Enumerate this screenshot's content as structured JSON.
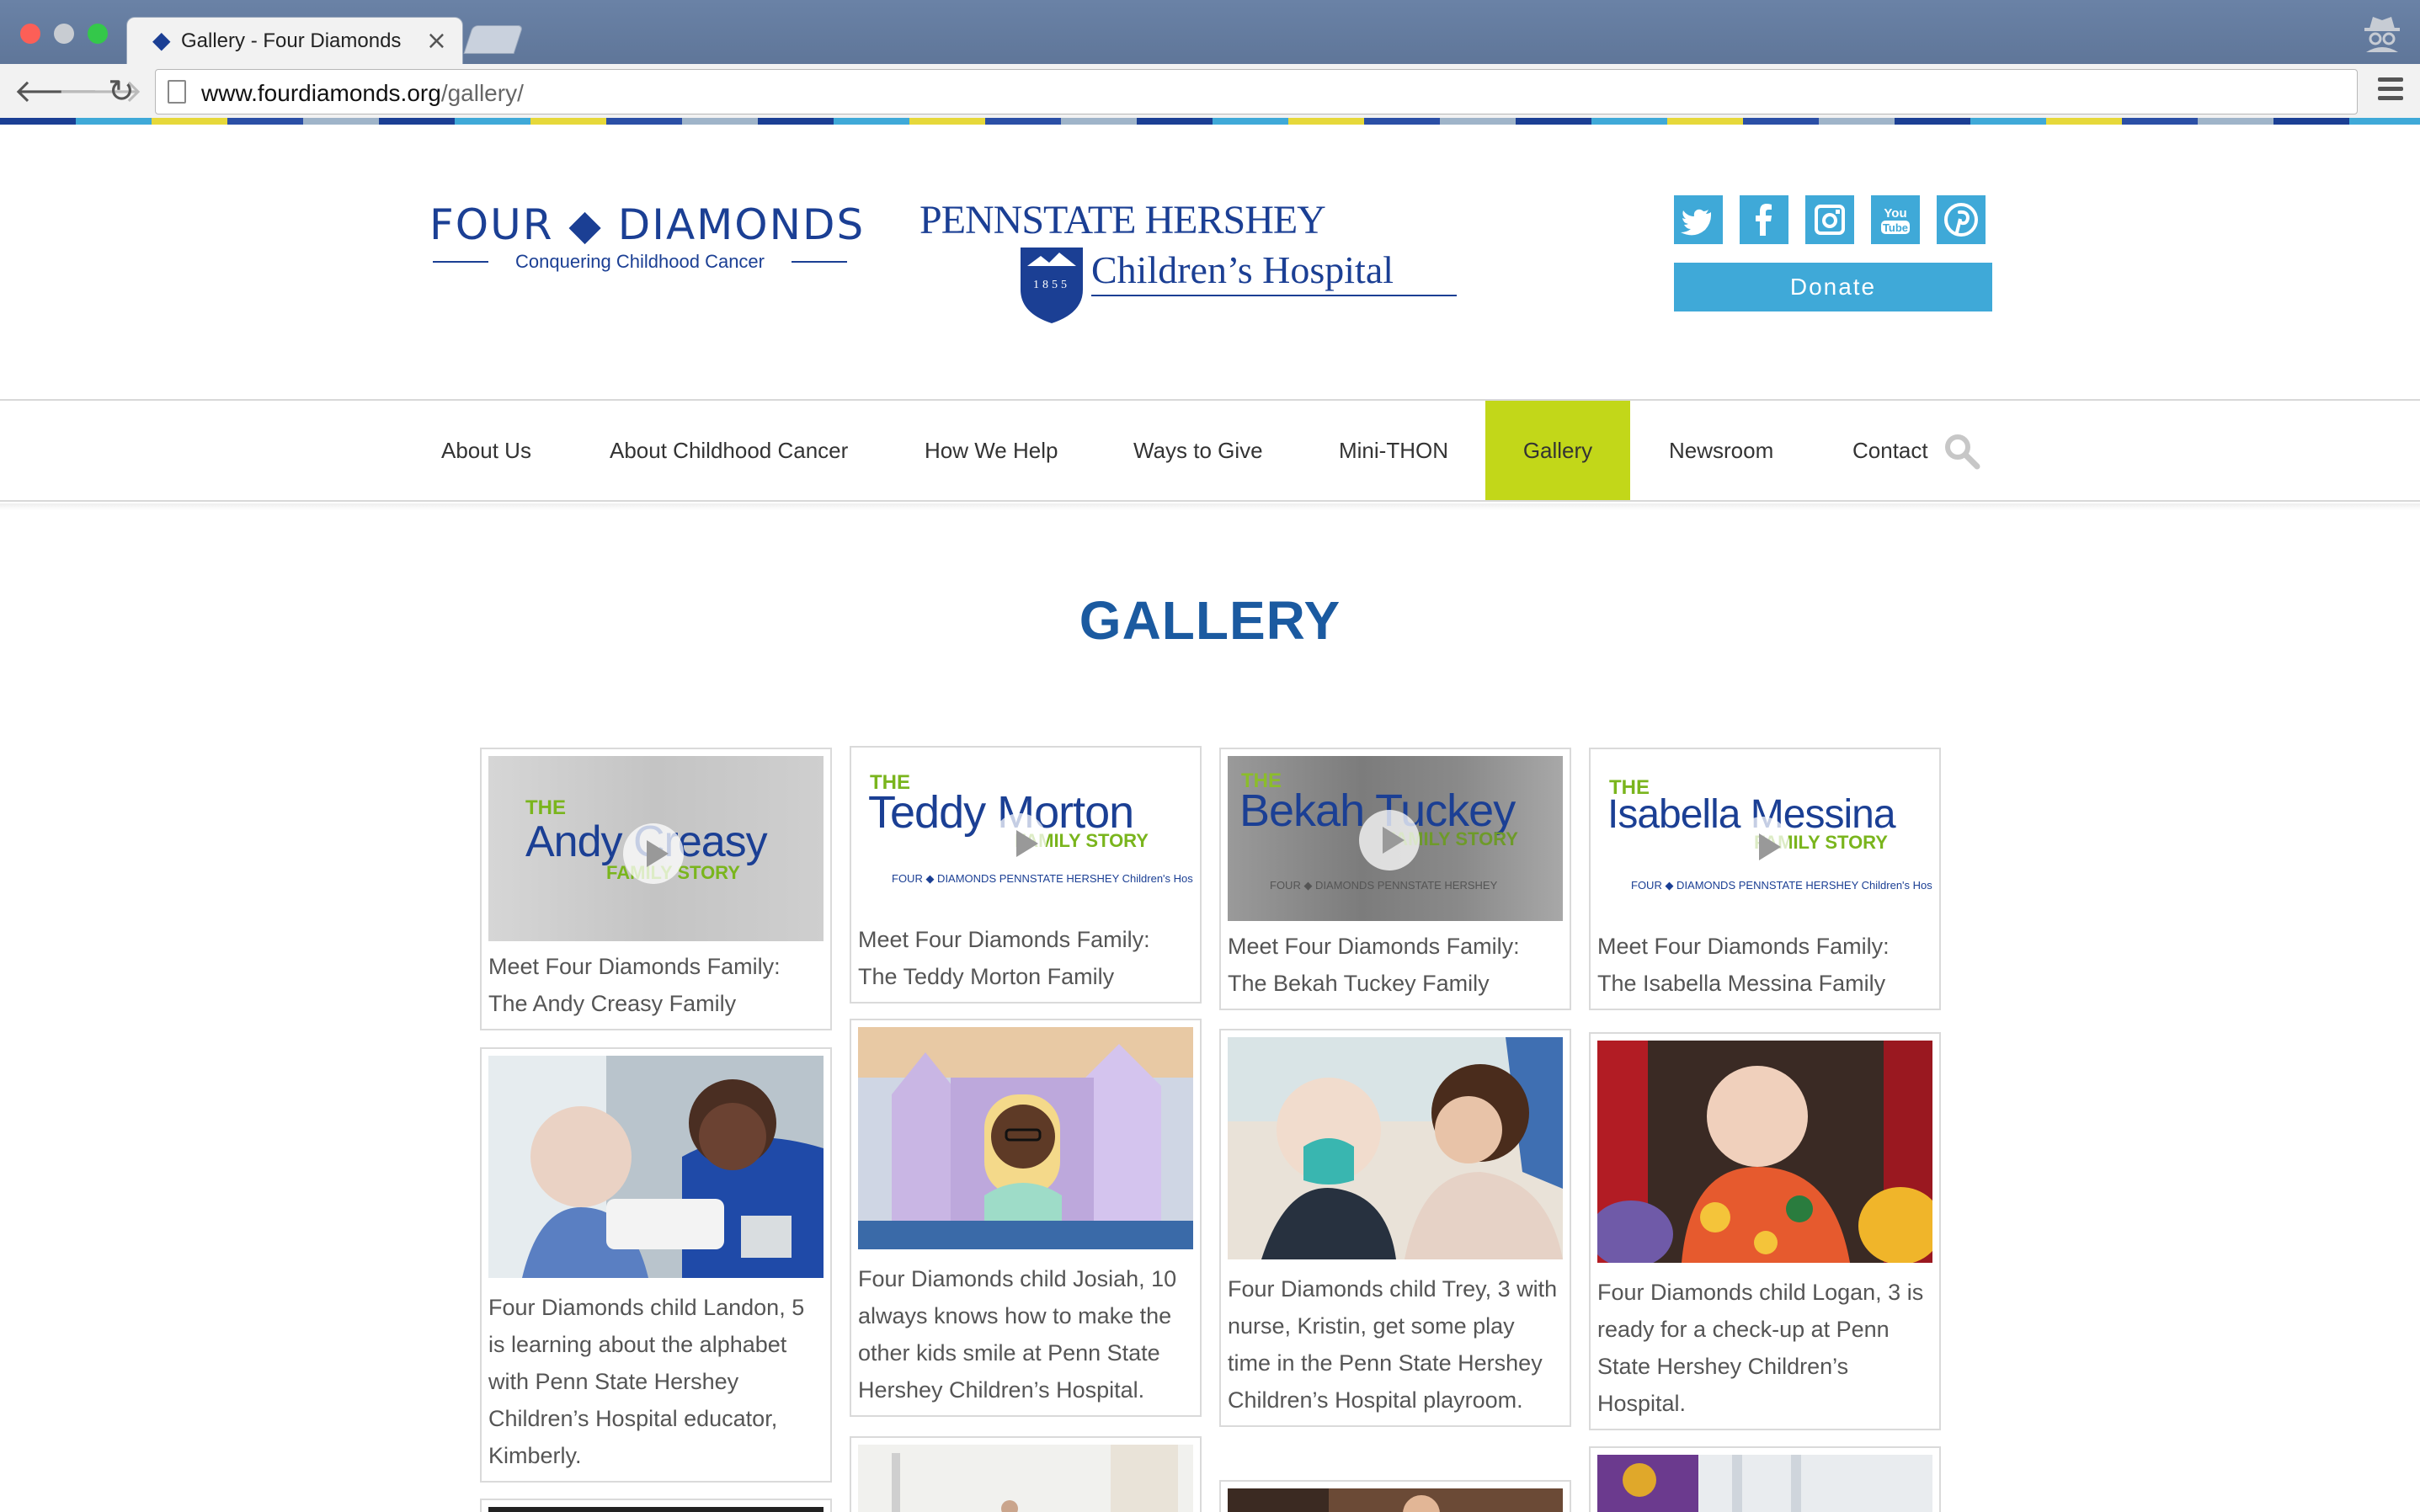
{
  "browser": {
    "tab_title": "Gallery - Four Diamonds",
    "tab_close": "×",
    "url_host": "www.fourdiamonds.org",
    "url_path": "/gallery/",
    "back_icon": "🡐",
    "forward_icon": "🡒",
    "reload_icon": "↻"
  },
  "header": {
    "fd_logo_main": "FOUR ◆ DIAMONDS",
    "fd_logo_tagline": "Conquering Childhood Cancer",
    "ps_logo_top": "PENNSTATE HERSHEY",
    "ps_logo_bottom": "Children’s Hospital",
    "ps_logo_year": "1855",
    "social_icons": [
      "twitter-icon",
      "facebook-icon",
      "instagram-icon",
      "youtube-icon",
      "pinterest-icon"
    ],
    "donate_label": "Donate"
  },
  "nav": {
    "items": [
      "About Us",
      "About Childhood Cancer",
      "How We Help",
      "Ways to Give",
      "Mini-THON",
      "Gallery",
      "Newsroom",
      "Contact"
    ],
    "active": "Gallery"
  },
  "page": {
    "title": "GALLERY"
  },
  "gallery": [
    {
      "type": "video",
      "thumb_the": "THE",
      "thumb_name": "Andy Creasy",
      "thumb_sub": "FAMILY STORY",
      "caption": "Meet Four Diamonds Family: The Andy Creasy Family"
    },
    {
      "type": "video",
      "thumb_the": "THE",
      "thumb_name": "Teddy Morton",
      "thumb_sub": "FAMILY STORY",
      "thumb_logos": "FOUR ◆ DIAMONDS   PENNSTATE HERSHEY Children's Hospital",
      "caption": "Meet Four Diamonds Family: The Teddy Morton Family"
    },
    {
      "type": "video",
      "thumb_the": "THE",
      "thumb_name": "Bekah Tuckey",
      "thumb_sub": "FAMILY STORY",
      "thumb_logos": "FOUR ◆ DIAMONDS   PENNSTATE HERSHEY",
      "caption": "Meet Four Diamonds Family: The Bekah Tuckey Family"
    },
    {
      "type": "video",
      "thumb_the": "THE",
      "thumb_name": "Isabella Messina",
      "thumb_sub": "FAMILY STORY",
      "thumb_logos": "FOUR ◆ DIAMONDS   PENNSTATE HERSHEY Children's Hospital",
      "caption": "Meet Four Diamonds Family: The Isabella Messina Family"
    },
    {
      "type": "photo",
      "caption": "Four Diamonds child Landon, 5 is learning about the alphabet with Penn State Hershey Children’s Hospital educator, Kimberly."
    },
    {
      "type": "photo",
      "caption": "Four Diamonds child Josiah, 10 always knows how to make the other kids smile at Penn State Hershey Children’s Hospital."
    },
    {
      "type": "photo",
      "caption": "Four Diamonds child Trey, 3 with nurse, Kristin, get some play time in the Penn State Hershey Children’s Hospital playroom."
    },
    {
      "type": "photo",
      "caption": "Four Diamonds child Logan, 3 is ready for a check-up at Penn State Hershey Children’s Hospital."
    }
  ]
}
